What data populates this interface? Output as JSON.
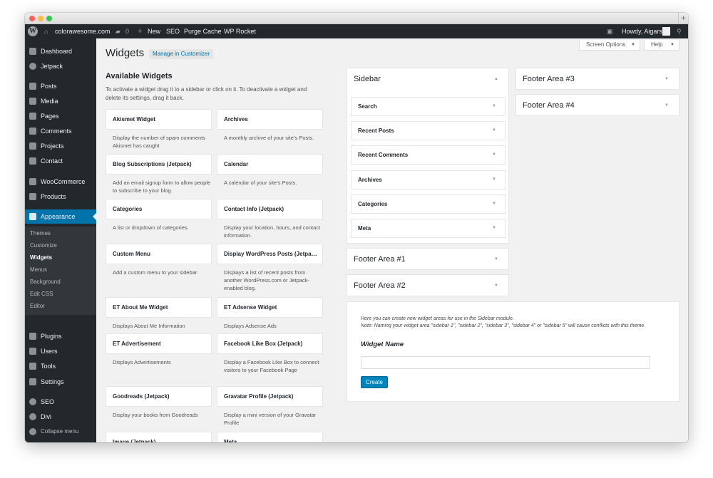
{
  "adminbar": {
    "site_name": "colorawesome.com",
    "comments_count": "0",
    "new_label": "New",
    "seo_label": "SEO",
    "purge_cache_label": "Purge Cache",
    "wp_rocket_label": "WP Rocket",
    "howdy_label": "Howdy, Aigars",
    "wp_logo_glyph": "W"
  },
  "sidebar": {
    "items": [
      {
        "label": "Dashboard",
        "icon": "dashboard-icon"
      },
      {
        "label": "Jetpack",
        "icon": "jetpack-icon"
      },
      {
        "label": "Posts",
        "icon": "pin-icon"
      },
      {
        "label": "Media",
        "icon": "media-icon"
      },
      {
        "label": "Pages",
        "icon": "pages-icon"
      },
      {
        "label": "Comments",
        "icon": "comments-icon"
      },
      {
        "label": "Projects",
        "icon": "pin-icon"
      },
      {
        "label": "Contact",
        "icon": "mail-icon"
      },
      {
        "label": "WooCommerce",
        "icon": "woocommerce-icon"
      },
      {
        "label": "Products",
        "icon": "products-icon"
      },
      {
        "label": "Appearance",
        "icon": "brush-icon"
      },
      {
        "label": "Plugins",
        "icon": "plugin-icon"
      },
      {
        "label": "Users",
        "icon": "users-icon"
      },
      {
        "label": "Tools",
        "icon": "wrench-icon"
      },
      {
        "label": "Settings",
        "icon": "settings-icon"
      },
      {
        "label": "SEO",
        "icon": "seo-icon"
      },
      {
        "label": "Divi",
        "icon": "divi-icon"
      },
      {
        "label": "Collapse menu",
        "icon": "collapse-icon"
      }
    ],
    "submenu": [
      "Themes",
      "Customize",
      "Widgets",
      "Menus",
      "Background",
      "Edit CSS",
      "Editor"
    ]
  },
  "header": {
    "screen_options": "Screen Options",
    "help": "Help",
    "title": "Widgets",
    "manage_customizer": "Manage in Customizer"
  },
  "available": {
    "title": "Available Widgets",
    "description": "To activate a widget drag it to a sidebar or click on it. To deactivate a widget and delete its settings, drag it back.",
    "widgets": [
      {
        "name": "Akismet Widget",
        "desc": "Display the number of spam comments Akismet has caught"
      },
      {
        "name": "Archives",
        "desc": "A monthly archive of your site’s Posts."
      },
      {
        "name": "Blog Subscriptions (Jetpack)",
        "desc": "Add an email signup form to allow people to subscribe to your blog."
      },
      {
        "name": "Calendar",
        "desc": "A calendar of your site’s Posts."
      },
      {
        "name": "Categories",
        "desc": "A list or dropdown of categories."
      },
      {
        "name": "Contact Info (Jetpack)",
        "desc": "Display your location, hours, and contact information."
      },
      {
        "name": "Custom Menu",
        "desc": "Add a custom menu to your sidebar."
      },
      {
        "name": "Display WordPress Posts (Jetpa…",
        "desc": "Displays a list of recent posts from another WordPress.com or Jetpack-enabled blog."
      },
      {
        "name": "ET About Me Widget",
        "desc": "Displays About Me Information"
      },
      {
        "name": "ET Adsense Widget",
        "desc": "Displays Adsense Ads"
      },
      {
        "name": "ET Advertisement",
        "desc": "Displays Advertisements"
      },
      {
        "name": "Facebook Like Box (Jetpack)",
        "desc": "Display a Facebook Like Box to connect visitors to your Facebook Page"
      },
      {
        "name": "Goodreads (Jetpack)",
        "desc": "Display your books from Goodreads"
      },
      {
        "name": "Gravatar Profile (Jetpack)",
        "desc": "Display a mini version of your Gravatar Profile"
      },
      {
        "name": "Image (Jetpack)",
        "desc": ""
      },
      {
        "name": "Meta",
        "desc": ""
      }
    ]
  },
  "areas": {
    "sidebar_title": "Sidebar",
    "sidebar_widgets": [
      "Search",
      "Recent Posts",
      "Recent Comments",
      "Archives",
      "Categories",
      "Meta"
    ],
    "footer1": "Footer Area #1",
    "footer2": "Footer Area #2",
    "footer3": "Footer Area #3",
    "footer4": "Footer Area #4"
  },
  "create_area": {
    "note": "Here you can create new widget areas for use in the Sidebar module.",
    "note2": "Note: Naming your widget area \"sidebar 1\", \"sidebar 2\", \"sidebar 3\", \"sidebar 4\" or \"sidebar 5\" will cause conflicts with this theme.",
    "label": "Widget Name",
    "value": "",
    "button": "Create"
  },
  "colors": {
    "accent": "#0073aa",
    "adminbar": "#23282d",
    "button": "#0085ba"
  }
}
